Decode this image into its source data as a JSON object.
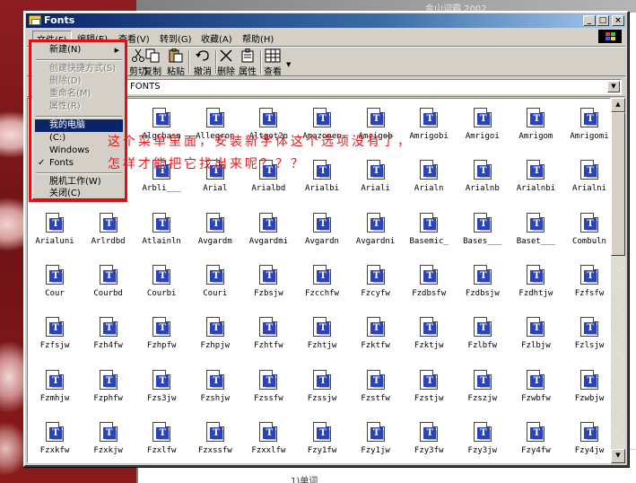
{
  "background_window": {
    "title": "金山词霸 2002",
    "footer_text": "1)单词"
  },
  "window": {
    "title": "Fonts",
    "controls": {
      "minimize": "_",
      "maximize": "□",
      "close": "×"
    }
  },
  "menubar": {
    "items": [
      {
        "label": "文件(F)"
      },
      {
        "label": "编辑(E)"
      },
      {
        "label": "查看(V)"
      },
      {
        "label": "转到(G)"
      },
      {
        "label": "收藏(A)"
      },
      {
        "label": "帮助(H)"
      }
    ]
  },
  "toolbar": {
    "cut": "剪切",
    "copy": "复制",
    "paste": "粘贴",
    "undo": "撤消",
    "delete": "删除",
    "properties": "属性",
    "view": "查看"
  },
  "address": {
    "value": "FONTS"
  },
  "file_menu": {
    "items": [
      {
        "label": "新建(N)",
        "state": "enabled",
        "submenu": true
      },
      {
        "label": "创建快捷方式(S)",
        "state": "disabled"
      },
      {
        "label": "删除(D)",
        "state": "disabled"
      },
      {
        "label": "重命名(M)",
        "state": "disabled"
      },
      {
        "label": "属性(R)",
        "state": "disabled"
      },
      {
        "label": "我的电脑",
        "state": "highlighted"
      },
      {
        "label": "(C:)",
        "state": "enabled"
      },
      {
        "label": "Windows",
        "state": "enabled"
      },
      {
        "label": "Fonts",
        "state": "checked"
      },
      {
        "label": "脱机工作(W)",
        "state": "enabled"
      },
      {
        "label": "关闭(C)",
        "state": "enabled"
      }
    ]
  },
  "annotation": {
    "line1": "这个菜单里面，安装新字体这个选项没有了，",
    "line2": "怎样才能把它找出来呢？？？"
  },
  "fonts": {
    "rows": [
      [
        "",
        "",
        "Algrbasn",
        "Allegron",
        "Altgot2n",
        "Amazonen",
        "Amrigob",
        "Amrigobi",
        "Amrigoi",
        "Amrigom",
        "Amrigomi"
      ],
      [
        "",
        "",
        "Arbli___",
        "Arial",
        "Arialbd",
        "Arialbi",
        "Ariali",
        "Arialn",
        "Arialnb",
        "Arialnbi",
        "Arialni"
      ],
      [
        "Arialuni",
        "Arlrdbd",
        "Atlainln",
        "Avgardm",
        "Avgardmi",
        "Avgardn",
        "Avgardni",
        "Basemic_",
        "Bases___",
        "Baset___",
        "Combuln"
      ],
      [
        "Cour",
        "Courbd",
        "Courbi",
        "Couri",
        "Fzbsjw",
        "Fzcchfw",
        "Fzcyfw",
        "Fzdbsfw",
        "Fzdbsjw",
        "Fzdhtjw",
        "Fzfsfw"
      ],
      [
        "Fzfsjw",
        "Fzh4fw",
        "Fzhpfw",
        "Fzhpjw",
        "Fzhtfw",
        "Fzhtjw",
        "Fzktfw",
        "Fzktjw",
        "Fzlbfw",
        "Fzlbjw",
        "Fzlsjw"
      ],
      [
        "Fzmhjw",
        "Fzphfw",
        "Fzs3jw",
        "Fzshjw",
        "Fzssfw",
        "Fzssjw",
        "Fzstfw",
        "Fzstjw",
        "Fzszjw",
        "Fzwbfw",
        "Fzwbjw"
      ],
      [
        "Fzxkfw",
        "Fzxkjw",
        "Fzxlfw",
        "Fzxssfw",
        "Fzxxlfw",
        "Fzy1fw",
        "Fzy1jw",
        "Fzy3fw",
        "Fzy3jw",
        "Fzy4fw",
        "Fzy4jw"
      ]
    ],
    "glyph": "T"
  }
}
